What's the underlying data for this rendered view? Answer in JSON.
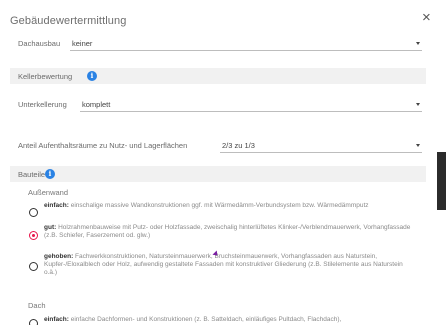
{
  "dialog": {
    "title": "Gebäudewertermittlung",
    "close_glyph": "×"
  },
  "dachausbau": {
    "label": "Dachausbau",
    "value": "keiner"
  },
  "kellerbewertung": {
    "header": "Kellerbewertung",
    "info_glyph": "i",
    "unterkellerung": {
      "label": "Unterkellerung",
      "value": "komplett"
    },
    "anteil": {
      "label": "Anteil Aufenthaltsräume zu Nutz- und Lagerflächen",
      "value": "2/3 zu 1/3"
    }
  },
  "bauteile": {
    "header": "Bauteile",
    "info_glyph": "i",
    "aussenwand": {
      "label": "Außenwand",
      "options": [
        {
          "key": "einfach:",
          "text": " einschalige massive Wandkonstruktionen ggf. mit Wärmedämm-Verbundsystem bzw. Wärmedämmputz",
          "selected": false
        },
        {
          "key": "gut:",
          "text": " Holzrahmenbauweise mit Putz- oder Holzfassade, zweischalig hinterlüftetes Klinker-/Verblendmauerwerk, Vorhangfassade (z.B. Schiefer, Faserzement od. glw.)",
          "selected": true
        },
        {
          "key": "gehoben:",
          "text": " Fachwerkkonstruktionen, Natursteinmauerwerk, Bruchsteinmauerwerk, Vorhangfassaden aus Naturstein, Kupfer-/Eloxalblech oder Holz, aufwendig gestaltete Fassaden mit konstruktiver Gliederung (z.B. Stilelemente aus Naturstein o.ä.)",
          "selected": false
        }
      ]
    },
    "dach": {
      "label": "Dach",
      "options": [
        {
          "key": "einfach:",
          "text": " einfache Dachformen- und Konstruktionen (z. B. Satteldach, einläufiges Pultdach, Flachdach),",
          "selected": false
        }
      ]
    }
  }
}
